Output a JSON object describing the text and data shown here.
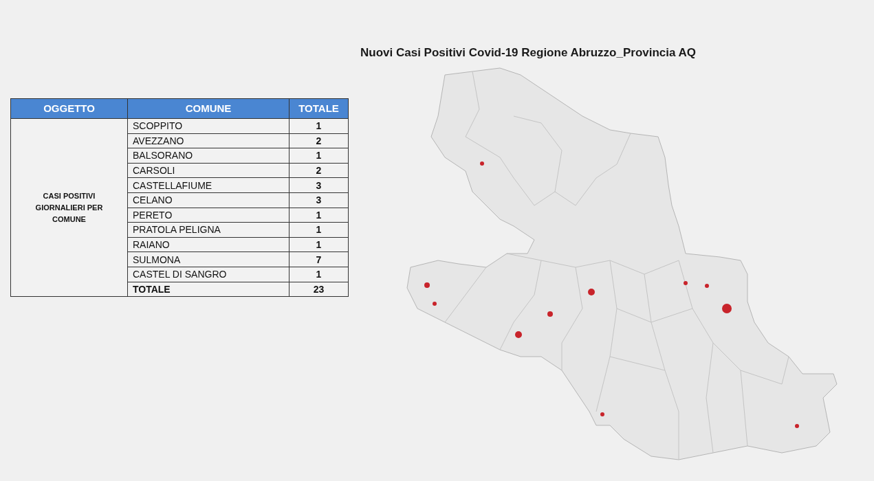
{
  "title": "Nuovi Casi Positivi Covid-19 Regione Abruzzo_Provincia AQ",
  "table": {
    "columns": [
      "OGGETTO",
      "COMUNE",
      "TOTALE"
    ],
    "group_label": "CASI POSITIVI GIORNALIERI PER COMUNE",
    "rows": [
      {
        "comune": "SCOPPITO",
        "totale": "1"
      },
      {
        "comune": "AVEZZANO",
        "totale": "2"
      },
      {
        "comune": "BALSORANO",
        "totale": "1"
      },
      {
        "comune": "CARSOLI",
        "totale": "2"
      },
      {
        "comune": "CASTELLAFIUME",
        "totale": "3"
      },
      {
        "comune": "CELANO",
        "totale": "3"
      },
      {
        "comune": "PERETO",
        "totale": "1"
      },
      {
        "comune": "PRATOLA PELIGNA",
        "totale": "1"
      },
      {
        "comune": "RAIANO",
        "totale": "1"
      },
      {
        "comune": "SULMONA",
        "totale": "7"
      },
      {
        "comune": "CASTEL DI SANGRO",
        "totale": "1"
      }
    ],
    "total": {
      "label": "TOTALE",
      "value": "23"
    }
  }
}
